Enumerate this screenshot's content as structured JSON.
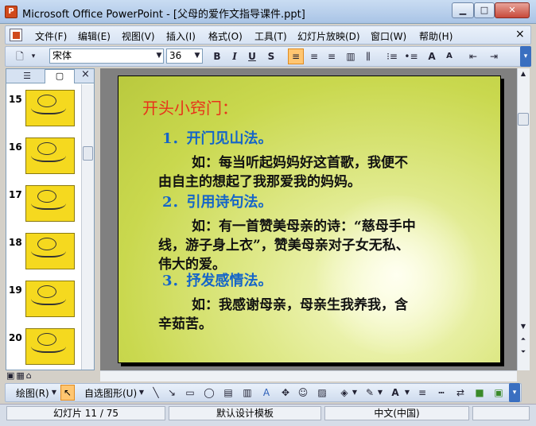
{
  "window": {
    "title": "Microsoft Office PowerPoint - [父母的爱作文指导课件.ppt]",
    "controls": {
      "minimize": "▁",
      "maximize": "□",
      "close": "✕"
    }
  },
  "menu": {
    "items": [
      "文件(F)",
      "编辑(E)",
      "视图(V)",
      "插入(I)",
      "格式(O)",
      "工具(T)",
      "幻灯片放映(D)",
      "窗口(W)",
      "帮助(H)"
    ],
    "close": "×"
  },
  "toolbar": {
    "font": "宋体",
    "font_size": "36",
    "bold": "B",
    "italic": "I",
    "underline": "U",
    "shadow": "S",
    "grow_font": "A",
    "shrink_font": "A"
  },
  "slide_pane": {
    "tabs": {
      "outline": "☰",
      "slides": "▢"
    },
    "close": "×",
    "slides": [
      {
        "number": "15"
      },
      {
        "number": "16"
      },
      {
        "number": "17"
      },
      {
        "number": "18"
      },
      {
        "number": "19"
      },
      {
        "number": "20"
      }
    ]
  },
  "slide": {
    "title": "开头小窍门：",
    "sections": [
      {
        "heading": "1．开门见山法。",
        "body": [
          "如：每当听起妈妈好这首歌，我便不",
          "由自主的想起了我那爱我的妈妈。"
        ]
      },
      {
        "heading": "2．引用诗句法。",
        "body": [
          "如：有一首赞美母亲的诗：“慈母手中",
          "线，游子身上衣”，赞美母亲对子女无私、",
          "伟大的爱。"
        ]
      },
      {
        "heading": "3．抒发感情法。",
        "body": [
          "如：我感谢母亲，母亲生我养我，含",
          "辛茹苦。"
        ]
      }
    ]
  },
  "drawing_toolbar": {
    "draw": "绘图(R)",
    "autoshapes": "自选图形(U)"
  },
  "status": {
    "slide": "幻灯片 11 / 75",
    "template": "默认设计模板",
    "language": "中文(中国)"
  },
  "colors": {
    "title_red": "#e8321a",
    "heading_blue": "#1565c8",
    "thumb_yellow": "#f5d91f",
    "active_tool": "#ffc671"
  }
}
